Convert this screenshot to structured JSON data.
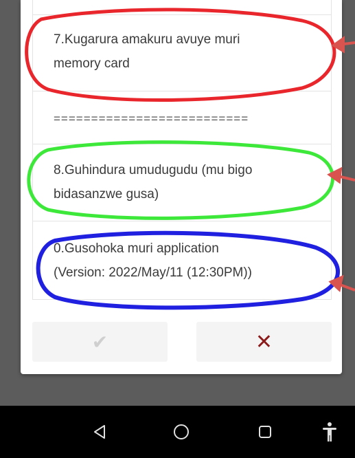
{
  "menu": {
    "items": [
      {
        "line1": "7.Kugarura amakuru avuye muri",
        "line2": "memory card"
      },
      {
        "line1": "==========================",
        "line2": ""
      },
      {
        "line1": "8.Guhindura umudugudu (mu bigo",
        "line2": "bidasanzwe gusa)"
      },
      {
        "line1": "0.Gusohoka muri application",
        "line2": "(Version: 2022/May/11 (12:30PM))"
      }
    ]
  },
  "buttons": {
    "ok_label": "✔",
    "cancel_label": "✕"
  },
  "annotations": {
    "red": "#e8262b",
    "green": "#3ee83a",
    "blue": "#2020e0",
    "arrow": "#d9534f"
  },
  "navbar": {
    "back": "back-icon",
    "home": "home-icon",
    "recents": "recents-icon",
    "accessibility": "accessibility-icon"
  }
}
